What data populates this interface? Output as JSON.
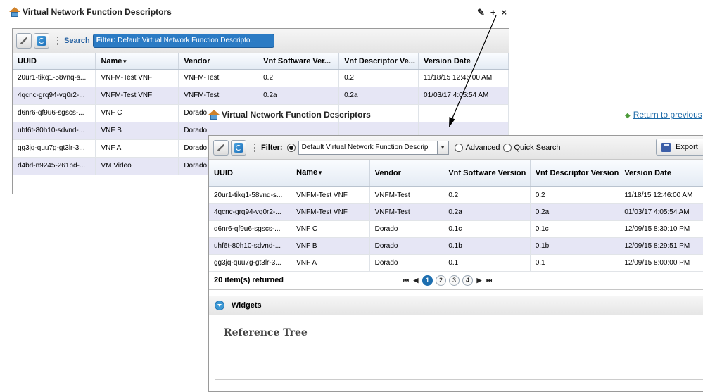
{
  "small_widget": {
    "title": "Virtual Network Function Descriptors",
    "window_icons": [
      "wrench-icon",
      "plus-icon",
      "close-icon"
    ],
    "window_glyphs": {
      "settings": "✎",
      "add": "+",
      "close": "×"
    },
    "search_label": "Search",
    "filter_prefix": "Filter:",
    "filter_text": "Default Virtual Network Function Descripto...",
    "columns": [
      "UUID",
      "Name",
      "Vendor",
      "Vnf Software Ver...",
      "Vnf Descriptor Ve...",
      "Version Date"
    ],
    "rows": [
      [
        "20ur1-tikq1-58vnq-s...",
        "VNFM-Test VNF",
        "VNFM-Test",
        "0.2",
        "0.2",
        "11/18/15 12:46:00 AM"
      ],
      [
        "4qcnc-grq94-vq0r2-...",
        "VNFM-Test VNF",
        "VNFM-Test",
        "0.2a",
        "0.2a",
        "01/03/17 4:05:54 AM"
      ],
      [
        "d6nr6-qf9u6-sgscs-...",
        "VNF C",
        "Dorado",
        "",
        "",
        ""
      ],
      [
        "uhf6t-80h10-sdvnd-...",
        "VNF B",
        "Dorado",
        "",
        "",
        ""
      ],
      [
        "gg3jq-quu7g-gt3lr-3...",
        "VNF A",
        "Dorado",
        "",
        "",
        ""
      ],
      [
        "d4brl-n9245-261pd-...",
        "VM Video",
        "Dorado",
        "",
        "",
        ""
      ]
    ]
  },
  "large_panel": {
    "title": "Virtual Network Function Descriptors",
    "return_link": "Return to previous",
    "filter_label": "Filter:",
    "filter_select_value": "Default Virtual Network Function Descrip",
    "advanced_label": "Advanced",
    "quick_search_label": "Quick Search",
    "export_label": "Export",
    "columns": [
      "UUID",
      "Name",
      "Vendor",
      "Vnf Software Version",
      "Vnf Descriptor Version",
      "Version Date"
    ],
    "rows": [
      [
        "20ur1-tikq1-58vnq-s...",
        "VNFM-Test VNF",
        "VNFM-Test",
        "0.2",
        "0.2",
        "11/18/15 12:46:00 AM"
      ],
      [
        "4qcnc-grq94-vq0r2-...",
        "VNFM-Test VNF",
        "VNFM-Test",
        "0.2a",
        "0.2a",
        "01/03/17 4:05:54 AM"
      ],
      [
        "d6nr6-qf9u6-sgscs-...",
        "VNF C",
        "Dorado",
        "0.1c",
        "0.1c",
        "12/09/15 8:30:10 PM"
      ],
      [
        "uhf6t-80h10-sdvnd-...",
        "VNF B",
        "Dorado",
        "0.1b",
        "0.1b",
        "12/09/15 8:29:51 PM"
      ],
      [
        "gg3jq-quu7g-gt3lr-3...",
        "VNF A",
        "Dorado",
        "0.1",
        "0.1",
        "12/09/15 8:00:00 PM"
      ]
    ],
    "items_returned": "20 item(s) returned",
    "pages": [
      "1",
      "2",
      "3",
      "4"
    ],
    "current_page": "1",
    "pager_glyphs": {
      "first": "⏮",
      "prev": "◀",
      "next": "▶",
      "last": "⏭"
    },
    "widgets_label": "Widgets",
    "reference_tree_label": "Reference Tree"
  },
  "colors": {
    "accent": "#2b7bc4",
    "alt_row": "#e6e6f5",
    "link": "#1c6aa8"
  }
}
